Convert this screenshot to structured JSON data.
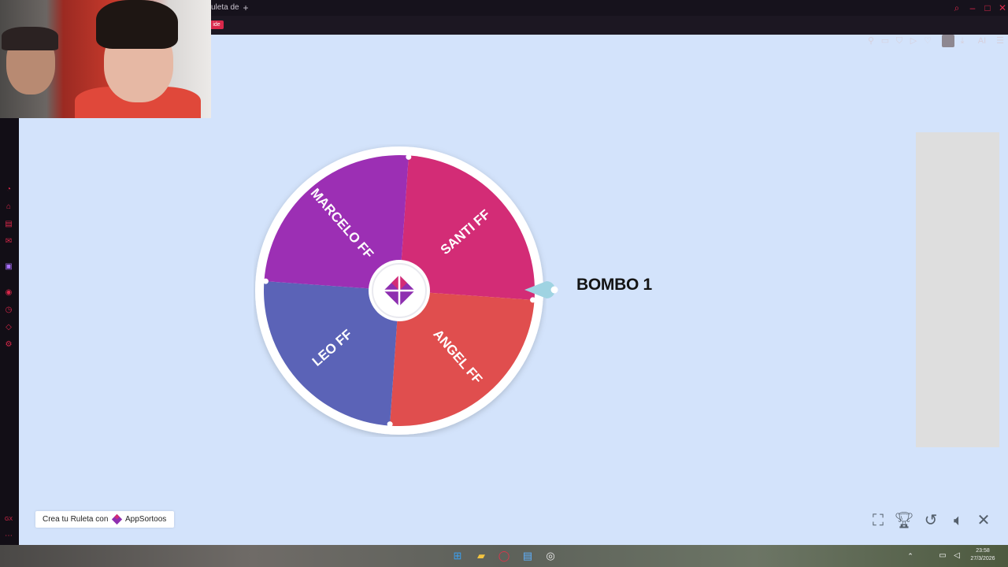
{
  "browser": {
    "tab_title": "uleta de",
    "new_tab": "+",
    "address_badge": "ide",
    "ai_label": "AI"
  },
  "wheel": {
    "segments": [
      {
        "label": "SANTI FF",
        "color": "#d32c76"
      },
      {
        "label": "ANGEL FF",
        "color": "#e04e4e"
      },
      {
        "label": "LEO FF",
        "color": "#5b63b7"
      },
      {
        "label": "MARCELO FF",
        "color": "#9c2fb4"
      }
    ],
    "rim_color": "#ffffff",
    "pointer_color": "#9fd3e2"
  },
  "winner_label": "BOMBO 1",
  "branding": {
    "prefix": "Crea tu Ruleta con",
    "app": "App",
    "name": "Sortoos"
  },
  "taskbar": {
    "time": "23:58",
    "date": "27/3/2026"
  },
  "icons": {
    "minimize": "minimize-icon",
    "maximize": "maximize-icon",
    "close": "close-icon",
    "fullscreen": "fullscreen-icon",
    "trophy": "trophy-icon",
    "reset": "reset-icon",
    "sound": "volume-icon",
    "exit": "close-icon"
  }
}
